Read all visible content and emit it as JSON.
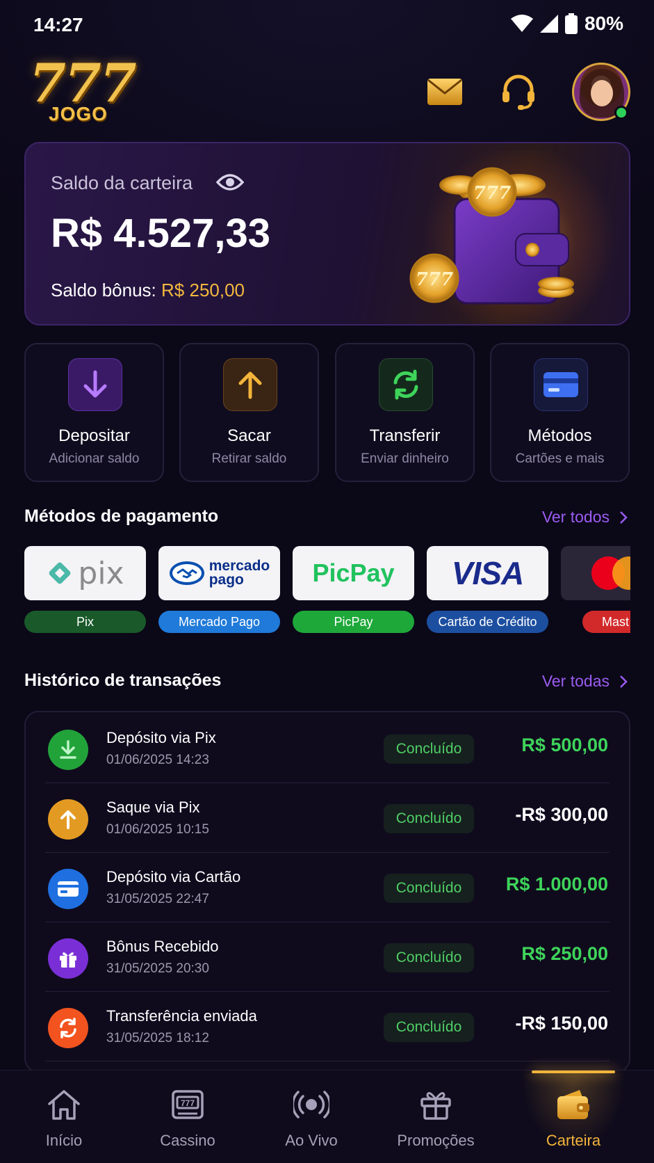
{
  "status_bar": {
    "time": "14:27",
    "battery": "80%"
  },
  "header": {
    "logo_number": "777",
    "logo_text": "JOGO",
    "icons": {
      "mail": "mail-icon",
      "support": "headset-icon",
      "avatar": "avatar"
    }
  },
  "balance": {
    "label": "Saldo da carteira",
    "amount": "R$ 4.527,33",
    "bonus_label": "Saldo bônus:",
    "bonus_amount": "R$ 250,00"
  },
  "actions": [
    {
      "title": "Depositar",
      "subtitle": "Adicionar saldo",
      "icon": "arrow-down-icon"
    },
    {
      "title": "Sacar",
      "subtitle": "Retirar saldo",
      "icon": "arrow-up-icon"
    },
    {
      "title": "Transferir",
      "subtitle": "Enviar dinheiro",
      "icon": "refresh-icon"
    },
    {
      "title": "Métodos",
      "subtitle": "Cartões e mais",
      "icon": "card-icon"
    }
  ],
  "payment_methods": {
    "title": "Métodos de pagamento",
    "see_all": "Ver todos",
    "items": [
      {
        "label": "Pix",
        "logo": "pix",
        "color": "#1a5a2a"
      },
      {
        "label": "Mercado Pago",
        "logo_line1": "mercado",
        "logo_line2": "pago",
        "color": "#1f7ad9"
      },
      {
        "label": "PicPay",
        "logo": "PicPay",
        "color": "#1fa83a"
      },
      {
        "label": "Cartão de Crédito",
        "logo": "VISA",
        "color": "#1d4fa0"
      },
      {
        "label": "Mast",
        "color": "#d22a2a"
      }
    ]
  },
  "transactions": {
    "title": "Histórico de transações",
    "see_all": "Ver todas",
    "items": [
      {
        "name": "Depósito via Pix",
        "date": "01/06/2025 14:23",
        "status": "Concluído",
        "amount": "R$ 500,00",
        "amount_color": "#3ed45a",
        "icon": "download-icon",
        "icon_color": "#22a33a"
      },
      {
        "name": "Saque via Pix",
        "date": "01/06/2025 10:15",
        "status": "Concluído",
        "amount": "-R$ 300,00",
        "amount_color": "#ffffff",
        "icon": "arrow-up-icon",
        "icon_color": "#e39a23"
      },
      {
        "name": "Depósito via Cartão",
        "date": "31/05/2025 22:47",
        "status": "Concluído",
        "amount": "R$ 1.000,00",
        "amount_color": "#3ed45a",
        "icon": "card-icon",
        "icon_color": "#1f6fe0"
      },
      {
        "name": "Bônus Recebido",
        "date": "31/05/2025 20:30",
        "status": "Concluído",
        "amount": "R$ 250,00",
        "amount_color": "#3ed45a",
        "icon": "gift-icon",
        "icon_color": "#7a2fd6"
      },
      {
        "name": "Transferência enviada",
        "date": "31/05/2025 18:12",
        "status": "Concluído",
        "amount": "-R$ 150,00",
        "amount_color": "#ffffff",
        "icon": "refresh-icon",
        "icon_color": "#f2531f"
      }
    ]
  },
  "bottom_nav": [
    {
      "label": "Início",
      "icon": "home-icon",
      "active": false
    },
    {
      "label": "Cassino",
      "icon": "slot-machine-icon",
      "active": false
    },
    {
      "label": "Ao Vivo",
      "icon": "live-icon",
      "active": false
    },
    {
      "label": "Promoções",
      "icon": "gift-icon",
      "active": false
    },
    {
      "label": "Carteira",
      "icon": "wallet-icon",
      "active": true
    }
  ]
}
